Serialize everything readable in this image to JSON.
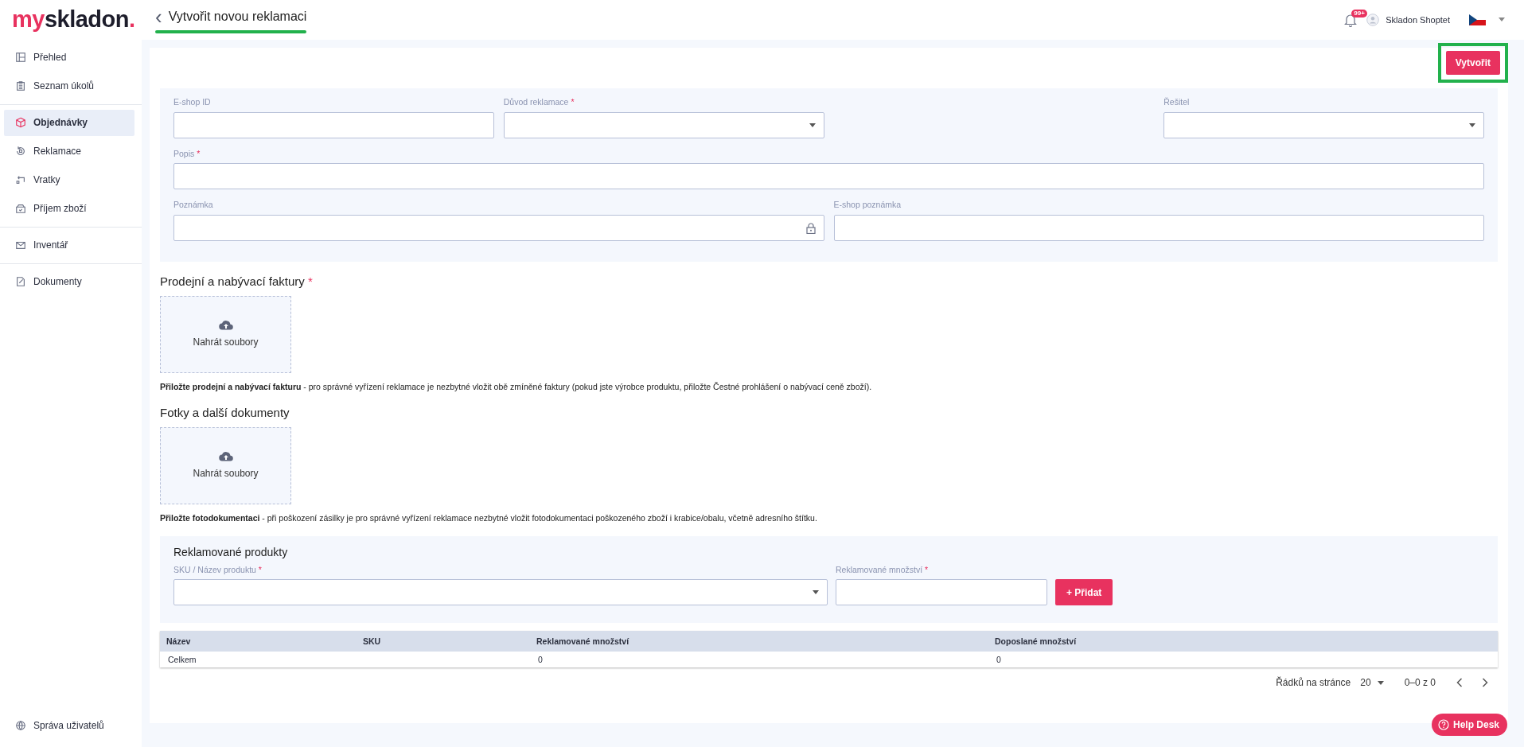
{
  "logo": {
    "parts": [
      {
        "text": "my",
        "color": "#e8325f"
      },
      {
        "text": "skladon",
        "color": "#1d1d2b"
      },
      {
        "text": ".",
        "color": "#e8325f"
      }
    ]
  },
  "header": {
    "back": "‹",
    "title": "Vytvořit novou reklamaci",
    "highlighted": true,
    "notification_count": "99+",
    "user": "Skladon Shoptet"
  },
  "sidebar": {
    "groups": [
      {
        "items": [
          {
            "label": "Přehled",
            "selected": false
          },
          {
            "label": "Seznam úkolů",
            "selected": false
          }
        ]
      },
      {
        "items": [
          {
            "label": "Objednávky",
            "selected": true
          },
          {
            "label": "Reklamace",
            "selected": false
          },
          {
            "label": "Vratky",
            "selected": false
          },
          {
            "label": "Příjem zboží",
            "selected": false
          }
        ]
      },
      {
        "items": [
          {
            "label": "Inventář",
            "selected": false
          }
        ]
      },
      {
        "items": [
          {
            "label": "Dokumenty",
            "selected": false
          }
        ]
      }
    ],
    "bottom_item": {
      "label": "Správa uživatelů",
      "selected": false
    }
  },
  "create_button": {
    "label": "Vytvořit",
    "highlighted": true
  },
  "form": {
    "fields": [
      {
        "label": "E-shop ID",
        "kind": "text"
      },
      {
        "label": "Důvod reklamace",
        "required_mark": "*",
        "kind": "select"
      },
      {
        "label": "Řešitel",
        "kind": "select"
      },
      {
        "label": "Popis",
        "required_mark": "*",
        "kind": "text"
      },
      {
        "label": "Poznámka",
        "kind": "locked"
      },
      {
        "label": "E-shop poznámka",
        "kind": "text"
      }
    ]
  },
  "uploads": [
    {
      "title": "Prodejní a nabývací faktury",
      "required_mark": "*",
      "upload_label": "Nahrát soubory",
      "note": "**Přiložte prodejní a nabývací fakturu** - pro správné vyřízení reklamace je nezbytné vložit obě zmíněné faktury (pokud jste výrobce produktu, přiložte Čestné prohlášení o nabývací ceně zboží)."
    },
    {
      "title": "Fotky a další dokumenty",
      "upload_label": "Nahrát soubory",
      "note": "**Přiložte fotodokumentaci** - při poškození zásilky je pro správné vyřízení reklamace nezbytné vložit fotodokumentaci poškozeného zboží i krabice/obalu, včetně adresního štítku."
    }
  ],
  "products": {
    "title": "Reklamované produkty",
    "fields": [
      {
        "label": "SKU / Název produktu",
        "required_mark": "*",
        "kind": "select"
      },
      {
        "label": "Reklamované množství",
        "required_mark": "*",
        "kind": "text"
      }
    ],
    "add_button": "+ Přidat"
  },
  "table": {
    "columns": [
      "Název",
      "SKU",
      "Reklamované množství",
      "Doposlané množství"
    ],
    "rows": [
      {
        "cells": [
          "Celkem",
          null,
          "0",
          "0"
        ]
      }
    ]
  },
  "pagination": {
    "rows_label": "Řádků na stránce",
    "rows_per_page": "20",
    "range": "0–0 z 0"
  },
  "help_desk": {
    "label": "Help Desk"
  }
}
